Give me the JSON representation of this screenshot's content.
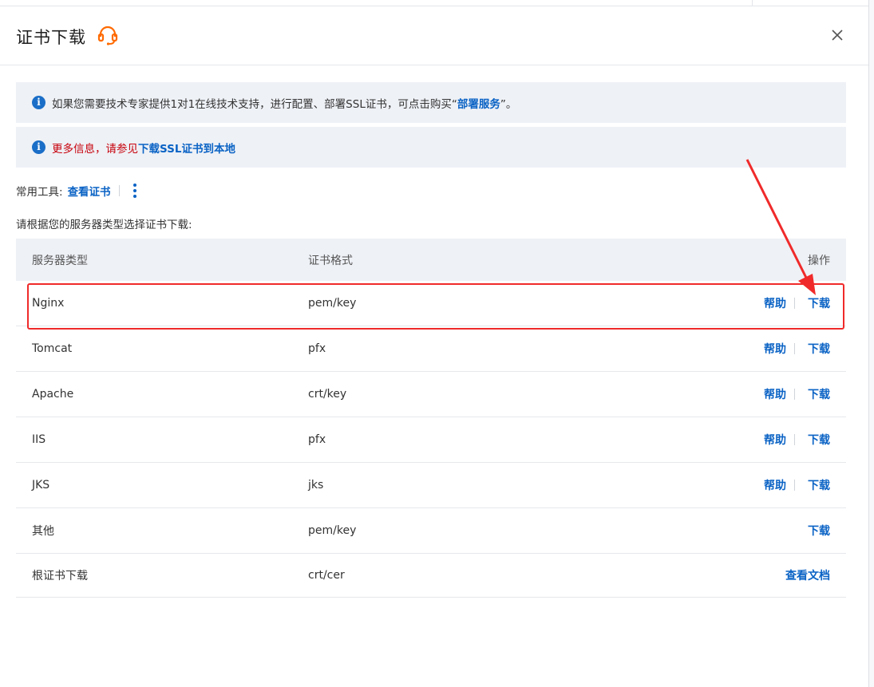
{
  "header": {
    "title": "证书下载",
    "close_icon": "close-icon",
    "support_icon": "headset-icon",
    "accent_color": "#ff6a00"
  },
  "notices": [
    {
      "icon": "info-icon",
      "prefix": "如果您需要技术专家提供1对1在线技术支持，进行配置、部署SSL证书，可点击购买“",
      "link": "部署服务",
      "suffix": "”。"
    },
    {
      "icon": "info-icon",
      "prefix": "更多信息，请参见",
      "link": "下载SSL证书到本地"
    }
  ],
  "tools": {
    "label": "常用工具:",
    "link": "查看证书",
    "more_icon": "more-vertical-icon"
  },
  "instruction": "请根据您的服务器类型选择证书下载:",
  "table": {
    "columns": [
      "服务器类型",
      "证书格式",
      "操作"
    ],
    "rows": [
      {
        "server": "Nginx",
        "format": "pem/key",
        "help": "帮助",
        "download": "下载"
      },
      {
        "server": "Tomcat",
        "format": "pfx",
        "help": "帮助",
        "download": "下载"
      },
      {
        "server": "Apache",
        "format": "crt/key",
        "help": "帮助",
        "download": "下载"
      },
      {
        "server": "IIS",
        "format": "pfx",
        "help": "帮助",
        "download": "下载"
      },
      {
        "server": "JKS",
        "format": "jks",
        "help": "帮助",
        "download": "下载"
      },
      {
        "server": "其他",
        "format": "pem/key",
        "download": "下载"
      },
      {
        "server": "根证书下载",
        "format": "crt/cer",
        "docs": "查看文档"
      }
    ]
  },
  "colors": {
    "link": "#0b63c5",
    "notice_bg": "#eef1f6",
    "annotation": "#f02a2a"
  }
}
